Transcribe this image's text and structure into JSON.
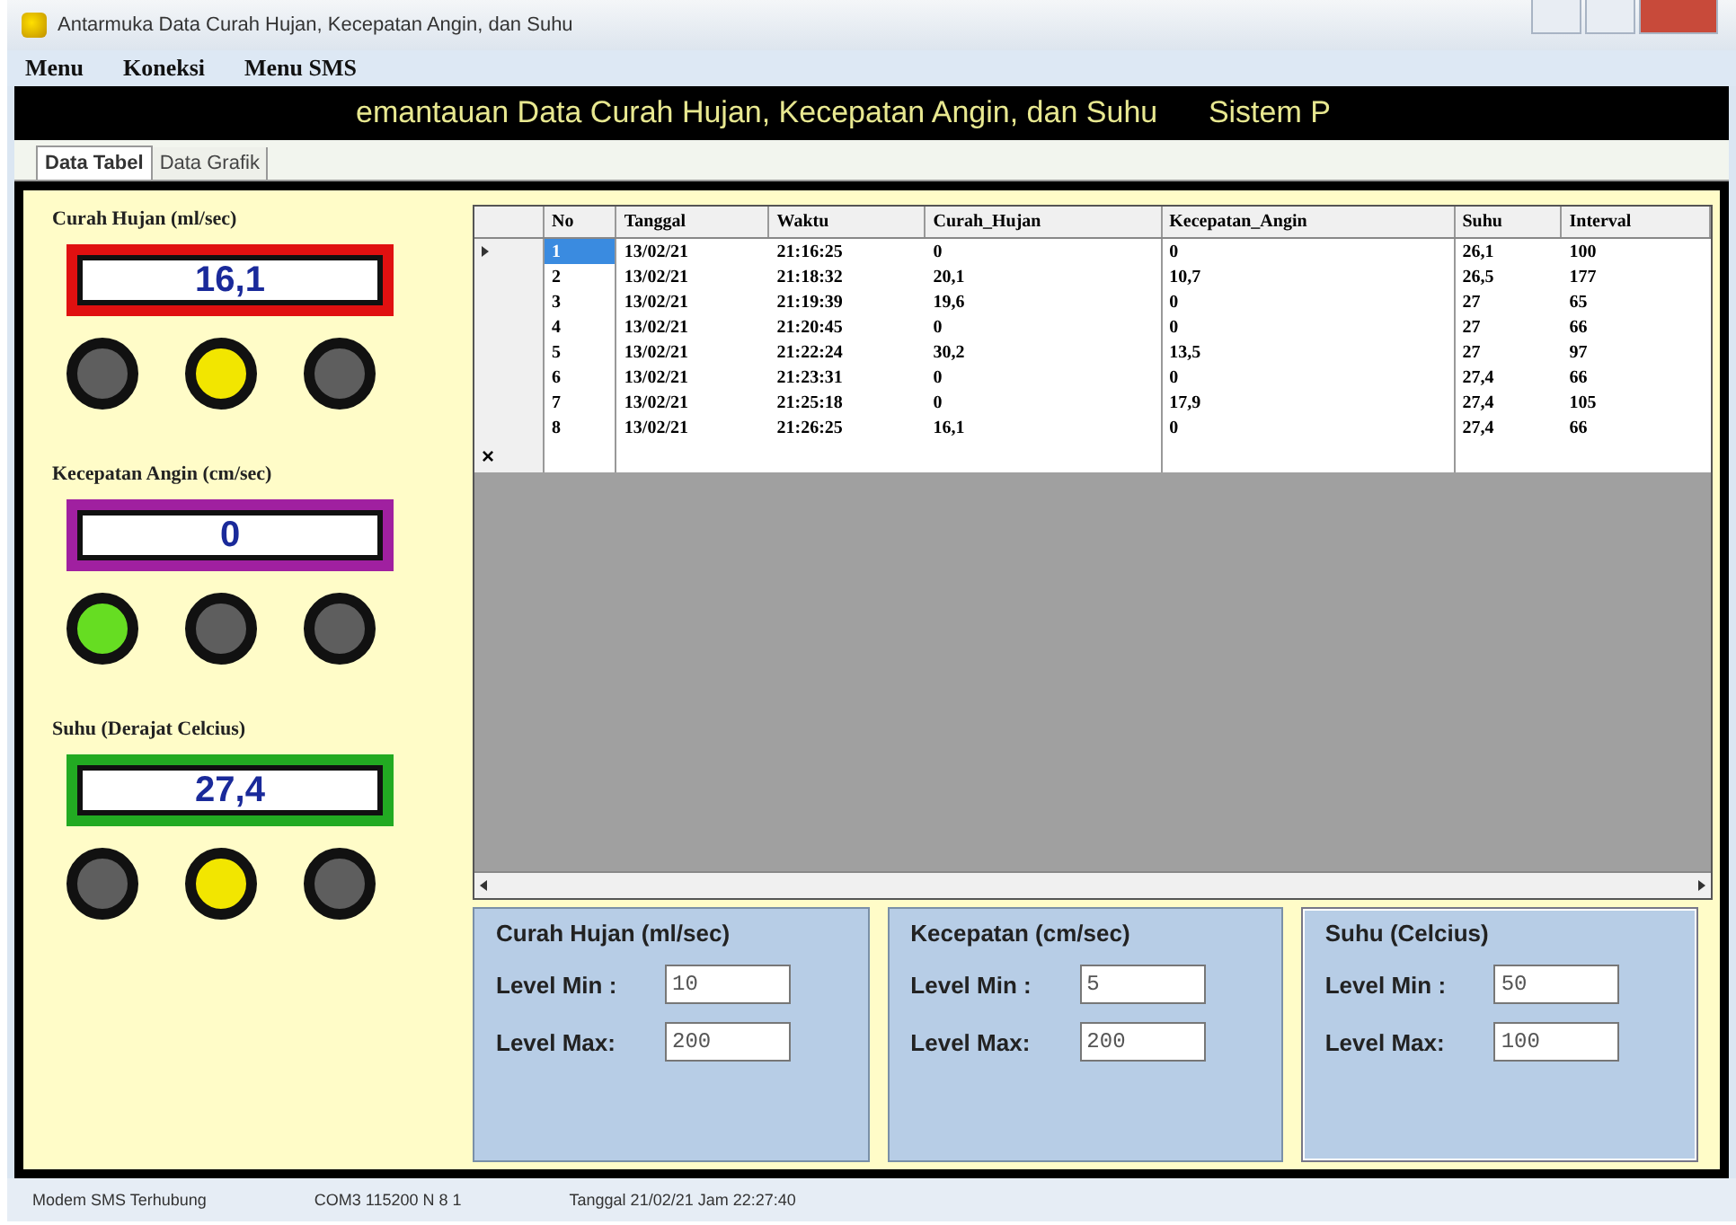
{
  "window": {
    "title": "Antarmuka Data Curah Hujan, Kecepatan Angin, dan Suhu"
  },
  "menu": [
    "Menu",
    "Koneksi",
    "Menu SMS"
  ],
  "banner": {
    "text": "emantauan Data Curah Hujan, Kecepatan Angin, dan Suhu      Sistem P"
  },
  "tabs": [
    {
      "label": "Data Tabel",
      "selected": true
    },
    {
      "label": "Data Grafik",
      "selected": false
    }
  ],
  "gauges": [
    {
      "label": "Curah Hujan (ml/sec)",
      "value": "16,1",
      "color": "#e01010",
      "lamps": [
        {
          "color": "#5e5e5e"
        },
        {
          "color": "#f2e600"
        },
        {
          "color": "#5e5e5e"
        }
      ]
    },
    {
      "label": "Kecepatan Angin (cm/sec)",
      "value": "0",
      "color": "#a020a0",
      "lamps": [
        {
          "color": "#66dd22"
        },
        {
          "color": "#5e5e5e"
        },
        {
          "color": "#5e5e5e"
        }
      ]
    },
    {
      "label": "Suhu (Derajat Celcius)",
      "value": "27,4",
      "color": "#22aa22",
      "lamps": [
        {
          "color": "#5e5e5e"
        },
        {
          "color": "#f2e600"
        },
        {
          "color": "#5e5e5e"
        }
      ]
    }
  ],
  "table": {
    "columns": [
      "No",
      "Tanggal",
      "Waktu",
      "Curah_Hujan",
      "Kecepatan_Angin",
      "Suhu",
      "Interval"
    ],
    "rows": [
      {
        "selected": true,
        "cells": [
          "1",
          "13/02/21",
          "21:16:25",
          "0",
          "0",
          "26,1",
          "100"
        ]
      },
      {
        "selected": false,
        "cells": [
          "2",
          "13/02/21",
          "21:18:32",
          "20,1",
          "10,7",
          "26,5",
          "177"
        ]
      },
      {
        "selected": false,
        "cells": [
          "3",
          "13/02/21",
          "21:19:39",
          "19,6",
          "0",
          "27",
          "65"
        ]
      },
      {
        "selected": false,
        "cells": [
          "4",
          "13/02/21",
          "21:20:45",
          "0",
          "0",
          "27",
          "66"
        ]
      },
      {
        "selected": false,
        "cells": [
          "5",
          "13/02/21",
          "21:22:24",
          "30,2",
          "13,5",
          "27",
          "97"
        ]
      },
      {
        "selected": false,
        "cells": [
          "6",
          "13/02/21",
          "21:23:31",
          "0",
          "0",
          "27,4",
          "66"
        ]
      },
      {
        "selected": false,
        "cells": [
          "7",
          "13/02/21",
          "21:25:18",
          "0",
          "17,9",
          "27,4",
          "105"
        ]
      },
      {
        "selected": false,
        "cells": [
          "8",
          "13/02/21",
          "21:26:25",
          "16,1",
          "0",
          "27,4",
          "66"
        ]
      }
    ],
    "new_row_mark": "×"
  },
  "limits": [
    {
      "kind": "panel",
      "title": "Curah Hujan (ml/sec)",
      "min_label": "Level Min :",
      "min": "10",
      "max_label": "Level Max:",
      "max": "200"
    },
    {
      "kind": "panel",
      "title": "Kecepatan (cm/sec)",
      "min_label": "Level Min :",
      "min": "5",
      "max_label": "Level Max:",
      "max": "200"
    },
    {
      "kind": "fieldset",
      "title": "Suhu (Celcius)",
      "min_label": "Level Min :",
      "min": "50",
      "max_label": "Level Max:",
      "max": "100"
    }
  ],
  "status_bar": [
    "Modem SMS Terhubung",
    "COM3 115200 N 8 1",
    "Tanggal 21/02/21 Jam 22:27:40"
  ]
}
